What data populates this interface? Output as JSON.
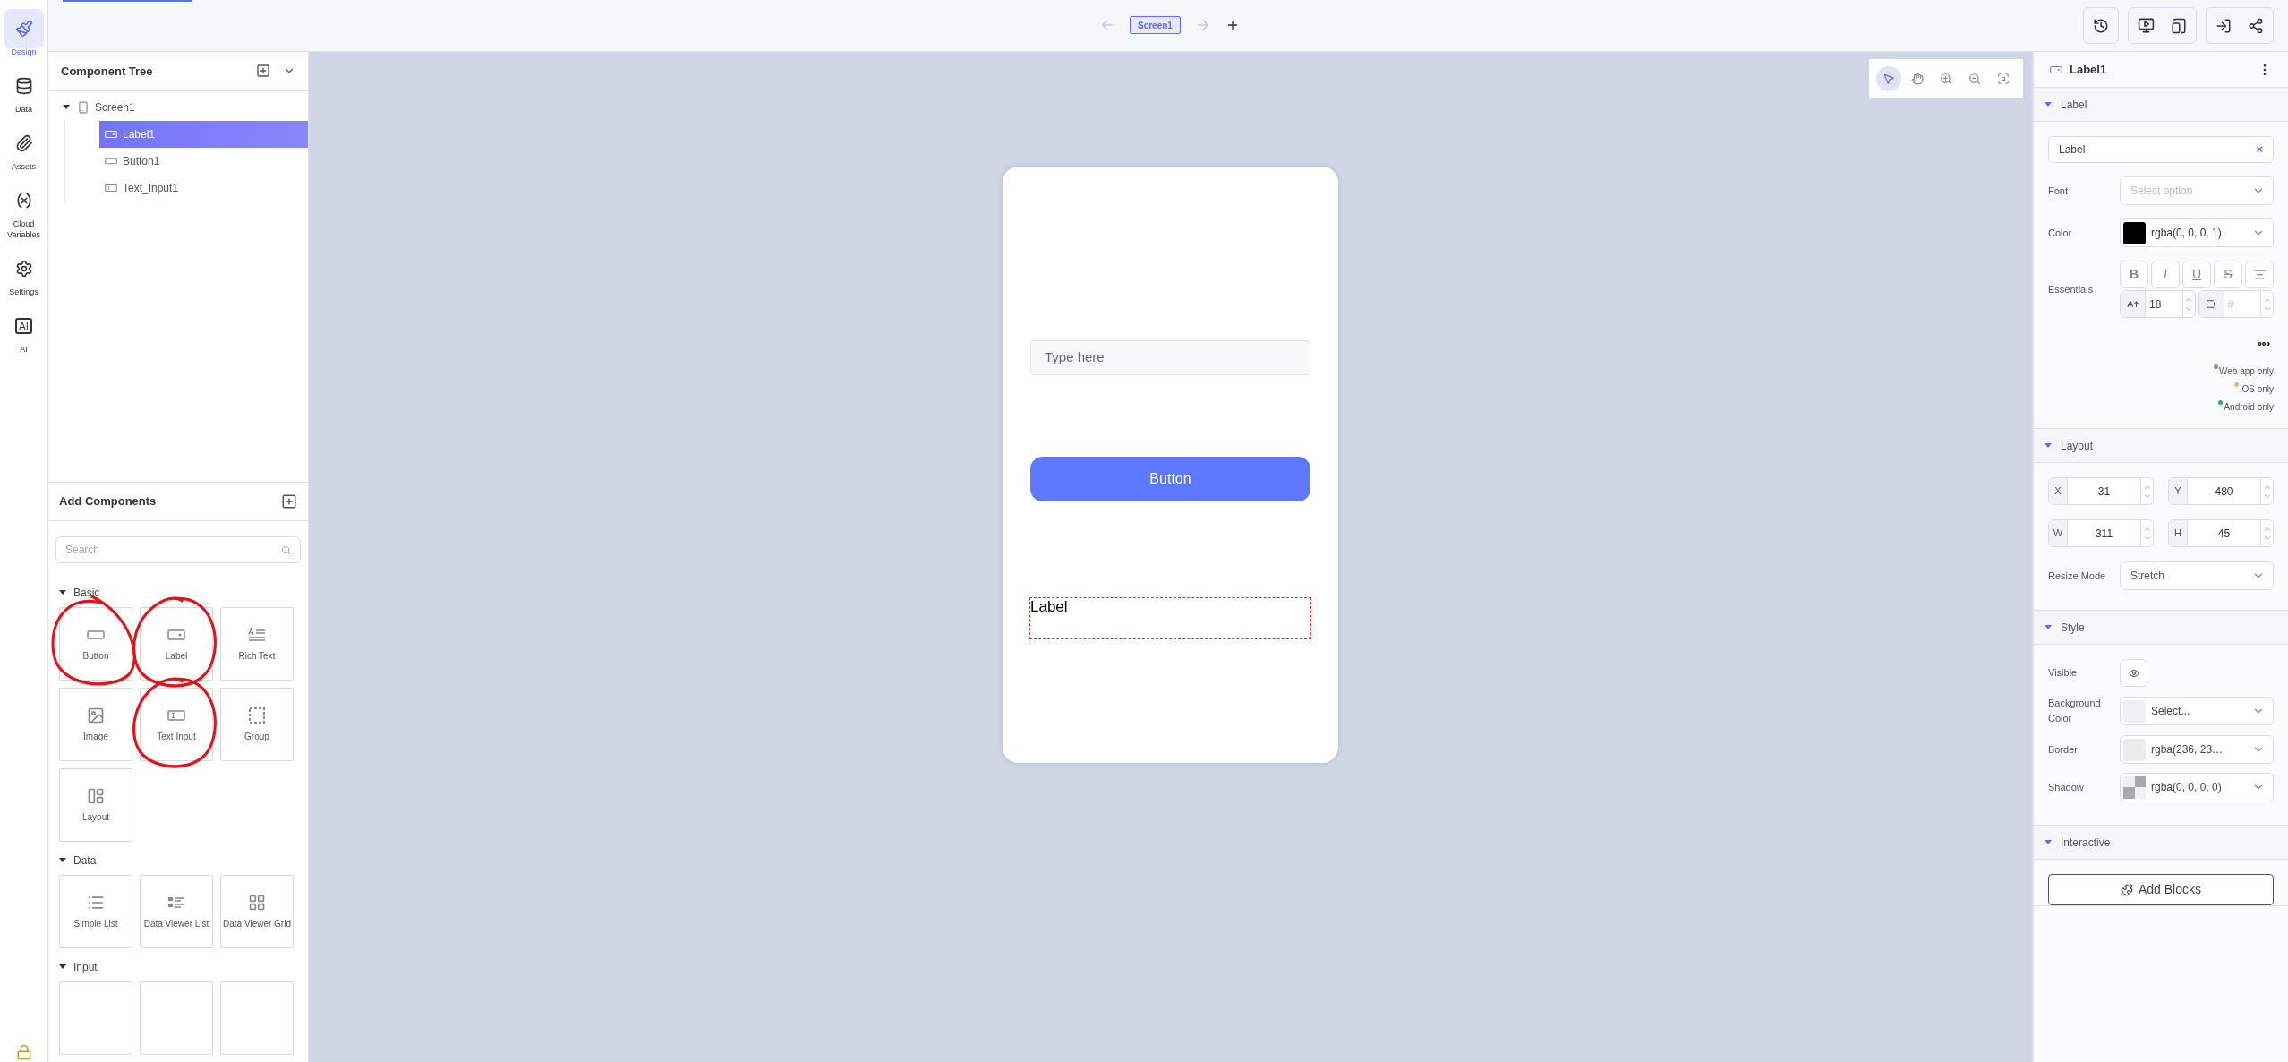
{
  "rail": [
    {
      "kind": "design",
      "label": "Design",
      "selected": true
    },
    {
      "kind": "data",
      "label": "Data",
      "selected": false
    },
    {
      "kind": "assets",
      "label": "Assets",
      "selected": false
    },
    {
      "kind": "variables",
      "label": "Cloud Variables",
      "selected": false
    },
    {
      "kind": "settings",
      "label": "Settings",
      "selected": false
    },
    {
      "kind": "ai",
      "label": "AI",
      "badge": "AI",
      "selected": false
    }
  ],
  "toolbar": {
    "screen_tab": "Screen1",
    "back_disabled": true,
    "forward_disabled": true
  },
  "tree": {
    "title": "Component Tree",
    "items": [
      {
        "kind": "screen",
        "label": "Screen1",
        "expanded": true,
        "selected": false,
        "children": [
          {
            "kind": "label",
            "label": "Label1",
            "selected": true
          },
          {
            "kind": "button",
            "label": "Button1",
            "selected": false
          },
          {
            "kind": "input",
            "label": "Text_Input1",
            "selected": false
          }
        ]
      }
    ]
  },
  "add_components": {
    "title": "Add Components",
    "search_placeholder": "Search",
    "categories": [
      {
        "label": "Basic",
        "expanded": true,
        "items": [
          {
            "kind": "button",
            "label": "Button",
            "circled": true
          },
          {
            "kind": "label",
            "label": "Label",
            "circled": true
          },
          {
            "kind": "richtext",
            "label": "Rich Text",
            "circled": false
          },
          {
            "kind": "image",
            "label": "Image",
            "circled": false
          },
          {
            "kind": "input",
            "label": "Text Input",
            "circled": true
          },
          {
            "kind": "group",
            "label": "Group",
            "circled": false
          },
          {
            "kind": "layout",
            "label": "Layout",
            "circled": false
          }
        ]
      },
      {
        "label": "Data",
        "expanded": true,
        "items": [
          {
            "kind": "list",
            "label": "Simple List",
            "circled": false
          },
          {
            "kind": "viewerlist",
            "label": "Data Viewer List",
            "circled": false
          },
          {
            "kind": "grid",
            "label": "Data Viewer Grid",
            "circled": false
          }
        ]
      },
      {
        "label": "Input",
        "expanded": true,
        "items": [
          {
            "kind": "blank",
            "circled": false
          },
          {
            "kind": "blank",
            "circled": false
          },
          {
            "kind": "blank",
            "circled": false
          }
        ]
      }
    ]
  },
  "canvas_tools": [
    {
      "kind": "select",
      "selected": true
    },
    {
      "kind": "pan",
      "selected": false
    },
    {
      "kind": "zoom_in",
      "selected": false
    },
    {
      "kind": "zoom_out",
      "selected": false
    },
    {
      "kind": "fit",
      "selected": false
    }
  ],
  "phone": {
    "elements": [
      {
        "kind": "input",
        "placeholder": "Type here",
        "selected": false
      },
      {
        "kind": "button",
        "label": "Button",
        "selected": false
      },
      {
        "kind": "label",
        "label": "Label",
        "selected": true
      }
    ]
  },
  "properties": {
    "component": "Label1",
    "label_section": {
      "title": "Label",
      "expanded": true,
      "text_value": "Label",
      "clear_glyph": "×",
      "font_label": "Font",
      "font_placeholder": "Select option",
      "color_label": "Color",
      "color_value": "rgba(0, 0, 0, 1)",
      "essentials_label": "Essentials",
      "format_buttons": [
        {
          "kind": "bold",
          "label": "B"
        },
        {
          "kind": "italic",
          "label": "I"
        },
        {
          "kind": "underline",
          "label": "U"
        },
        {
          "kind": "strike",
          "label": "S"
        },
        {
          "kind": "align"
        }
      ],
      "font_size": "18",
      "line_height_placeholder": "#",
      "platforms": [
        {
          "label": "Web app only",
          "color": "#7b8cf5"
        },
        {
          "label": "iOS only",
          "color": "#f5b85b"
        },
        {
          "label": "Android only",
          "color": "#22b573"
        }
      ]
    },
    "layout_section": {
      "title": "Layout",
      "expanded": true,
      "fields": [
        {
          "axis": "X",
          "value": "31"
        },
        {
          "axis": "Y",
          "value": "480"
        },
        {
          "axis": "W",
          "value": "311"
        },
        {
          "axis": "H",
          "value": "45"
        }
      ],
      "resize_label": "Resize Mode",
      "resize_value": "Stretch"
    },
    "style_section": {
      "title": "Style",
      "expanded": true,
      "visible_label": "Visible",
      "visible": true,
      "rows": [
        {
          "label": "Background Color",
          "value": "Select...",
          "kind": "plain"
        },
        {
          "label": "Border",
          "value": "rgba(236, 23…",
          "kind": "grey"
        },
        {
          "label": "Shadow",
          "value": "rgba(0, 0, 0, 0)",
          "kind": "checker"
        }
      ]
    },
    "interactive_section": {
      "title": "Interactive",
      "expanded": true,
      "button": "Add Blocks"
    }
  }
}
